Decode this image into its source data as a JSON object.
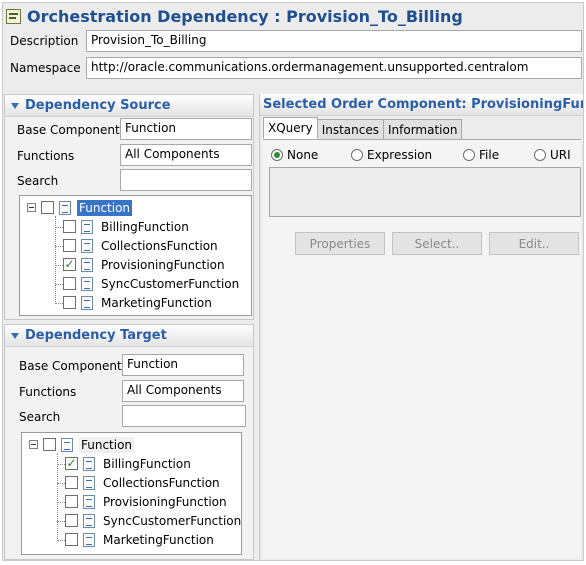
{
  "header": {
    "title": "Orchestration Dependency : Provision_To_Billing",
    "title_icon": "dependency-editor-icon"
  },
  "fields": {
    "description_label": "Description",
    "description_value": "Provision_To_Billing",
    "namespace_label": "Namespace",
    "namespace_value": "http://oracle.communications.ordermanagement.unsupported.centralom"
  },
  "source": {
    "title": "Dependency Source",
    "base_component_label": "Base Component",
    "base_component_value": "Function",
    "functions_label": "Functions",
    "functions_value": "All Components",
    "search_label": "Search",
    "search_value": "",
    "tree_root": "Function",
    "items": [
      {
        "label": "BillingFunction",
        "checked": false
      },
      {
        "label": "CollectionsFunction",
        "checked": false
      },
      {
        "label": "ProvisioningFunction",
        "checked": true
      },
      {
        "label": "SyncCustomerFunction",
        "checked": false
      },
      {
        "label": "MarketingFunction",
        "checked": false
      }
    ]
  },
  "target": {
    "title": "Dependency Target",
    "base_component_label": "Base Component",
    "base_component_value": "Function",
    "functions_label": "Functions",
    "functions_value": "All Components",
    "search_label": "Search",
    "search_value": "",
    "tree_root": "Function",
    "items": [
      {
        "label": "BillingFunction",
        "checked": true
      },
      {
        "label": "CollectionsFunction",
        "checked": false
      },
      {
        "label": "ProvisioningFunction",
        "checked": false
      },
      {
        "label": "SyncCustomerFunction",
        "checked": false
      },
      {
        "label": "MarketingFunction",
        "checked": false
      }
    ]
  },
  "right": {
    "title": "Selected Order Component: ProvisioningFunction",
    "tabs": [
      "XQuery",
      "Instances",
      "Information"
    ],
    "active_tab": "XQuery",
    "radios": [
      "None",
      "Expression",
      "File",
      "URI"
    ],
    "selected_radio": "None",
    "buttons": [
      "Properties",
      "Select..",
      "Edit.."
    ]
  },
  "colors": {
    "accent_blue": "#2a5ea8",
    "selection_blue": "#3874c8",
    "check_green": "#1f8a1f"
  }
}
